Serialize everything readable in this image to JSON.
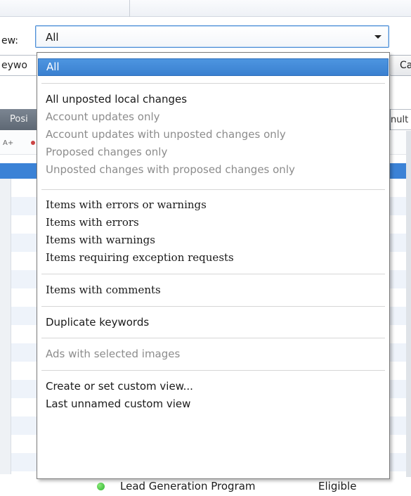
{
  "view": {
    "label": "ew:",
    "selected_value": "All"
  },
  "keyword_field_text": "eywo",
  "right_button_label": "Ca",
  "grid_header": {
    "left_label": "Posi",
    "right_label": "nult"
  },
  "bottom_row": {
    "campaign": "Lead Generation Program",
    "status": "Eligible",
    "status_color": "#2cb52c"
  },
  "colors": {
    "accent": "#3b82d6",
    "disabled_text": "#8c8c8c"
  },
  "dropdown": {
    "options": [
      {
        "label": "All",
        "enabled": true,
        "selected": true
      },
      {
        "label": "All unposted local changes",
        "enabled": true,
        "selected": false
      },
      {
        "label": "Account updates only",
        "enabled": false,
        "selected": false
      },
      {
        "label": "Account updates with unposted changes only",
        "enabled": false,
        "selected": false
      },
      {
        "label": "Proposed changes only",
        "enabled": false,
        "selected": false
      },
      {
        "label": "Unposted changes with proposed changes only",
        "enabled": false,
        "selected": false
      },
      {
        "label": "Items with errors or warnings",
        "enabled": true,
        "selected": false
      },
      {
        "label": "Items with errors",
        "enabled": true,
        "selected": false
      },
      {
        "label": "Items with warnings",
        "enabled": true,
        "selected": false
      },
      {
        "label": "Items requiring exception requests",
        "enabled": true,
        "selected": false
      },
      {
        "label": "Items with comments",
        "enabled": true,
        "selected": false
      },
      {
        "label": "Duplicate keywords",
        "enabled": true,
        "selected": false
      },
      {
        "label": "Ads with selected images",
        "enabled": false,
        "selected": false
      },
      {
        "label": "Create or set custom view...",
        "enabled": true,
        "selected": false
      },
      {
        "label": "Last unnamed custom view",
        "enabled": true,
        "selected": false
      }
    ]
  }
}
